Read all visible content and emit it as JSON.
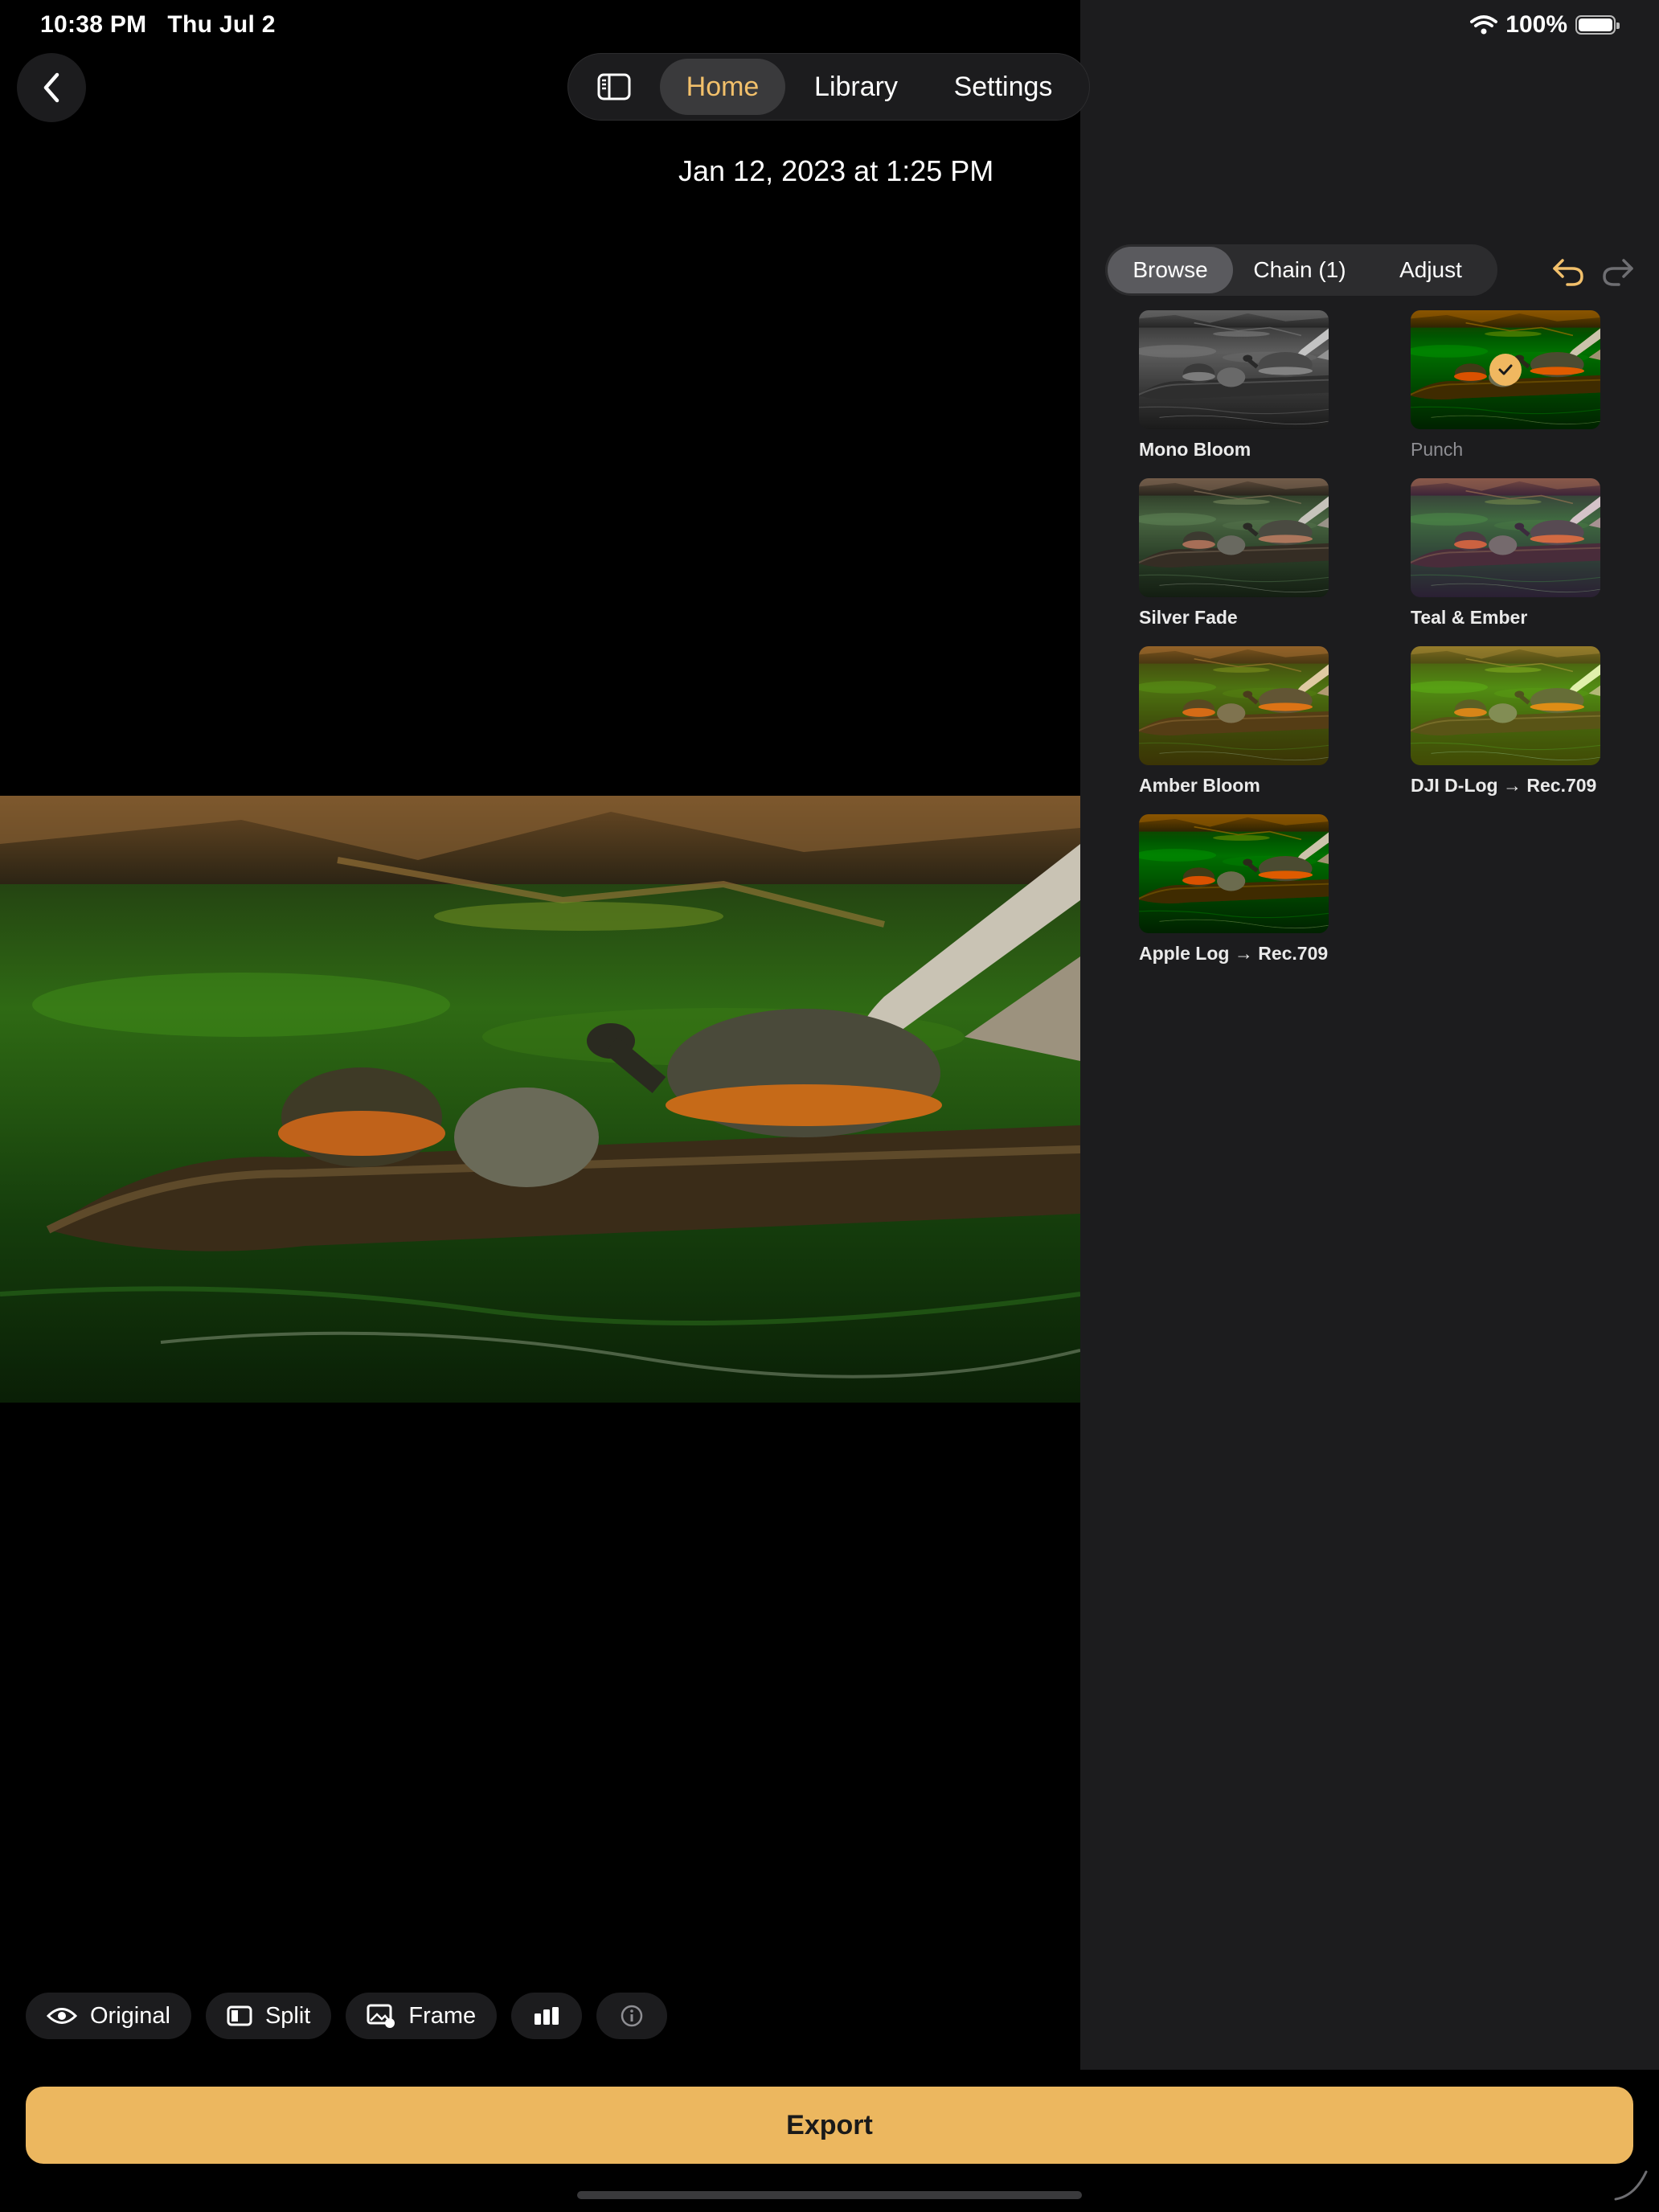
{
  "status_bar": {
    "time": "10:38 PM",
    "date": "Thu Jul 2",
    "battery": "100%"
  },
  "nav": {
    "tabs": [
      {
        "label": "Home"
      },
      {
        "label": "Library"
      },
      {
        "label": "Settings"
      }
    ],
    "active": "Home"
  },
  "photo": {
    "date": "Jan 12, 2023 at 1:25 PM"
  },
  "panel": {
    "segments": [
      {
        "label": "Browse"
      },
      {
        "label": "Chain (1)"
      },
      {
        "label": "Adjust"
      }
    ],
    "active_segment": "Browse",
    "presets": [
      {
        "name": "Mono Bloom"
      },
      {
        "name": "Punch",
        "selected": true
      },
      {
        "name": "Silver Fade"
      },
      {
        "name": "Teal & Ember"
      },
      {
        "name": "Amber Bloom"
      },
      {
        "name": "DJI D-Log → Rec.709"
      },
      {
        "name": "Apple Log → Rec.709"
      }
    ]
  },
  "toolbar": {
    "original": "Original",
    "split": "Split",
    "frame": "Frame"
  },
  "export_label": "Export",
  "colors": {
    "accent": "#f2c06b",
    "export_bg": "#ecb75f",
    "sidebar_bg": "#1c1c1e"
  }
}
